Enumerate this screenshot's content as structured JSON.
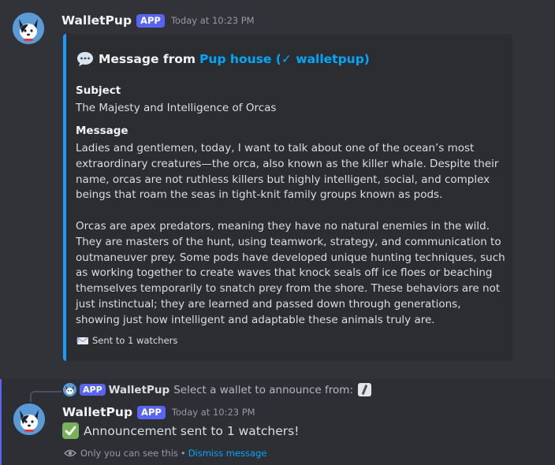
{
  "message1": {
    "username": "WalletPup",
    "badge": "APP",
    "timestamp": "Today at 10:23 PM",
    "embed": {
      "accent_color": "#1f9bff",
      "title_prefix": "Message from",
      "title_link": "Pup house (✓ walletpup)",
      "subject_label": "Subject",
      "subject_value": "The Majesty and Intelligence of Orcas",
      "message_label": "Message",
      "paragraph1": "Ladies and gentlemen, today, I want to talk about one of the ocean’s most extraordinary creatures—the orca, also known as the killer whale. Despite their name, orcas are not ruthless killers but highly intelligent, social, and complex beings that roam the seas in tight-knit family groups known as pods.",
      "paragraph2": "Orcas are apex predators, meaning they have no natural enemies in the wild. They are masters of the hunt, using teamwork, strategy, and communication to outmaneuver prey. Some pods have developed unique hunting techniques, such as working together to create waves that knock seals off ice floes or beaching themselves temporarily to snatch prey from the shore. These behaviors are not just instinctual; they are learned and passed down through generations, showing just how intelligent and adaptable these animals truly are.",
      "footer": "Sent to 1 watchers",
      "title_icon": "speech-balloon-icon",
      "footer_icon": "incoming-envelope-icon"
    }
  },
  "message2": {
    "reply": {
      "badge": "APP",
      "username": "WalletPup",
      "text": "Select a wallet to announce from:",
      "icon": "slash-command-icon"
    },
    "username": "WalletPup",
    "badge": "APP",
    "timestamp": "Today at 10:23 PM",
    "content": "Announcement sent to 1 watchers!",
    "content_icon": "check-mark-icon",
    "ephemeral_text": "Only you can see this",
    "separator": "•",
    "dismiss_label": "Dismiss message"
  },
  "colors": {
    "background": "#323339",
    "embed_background": "#2b2d31",
    "app_badge": "#5865f2",
    "link": "#00a8fc"
  }
}
